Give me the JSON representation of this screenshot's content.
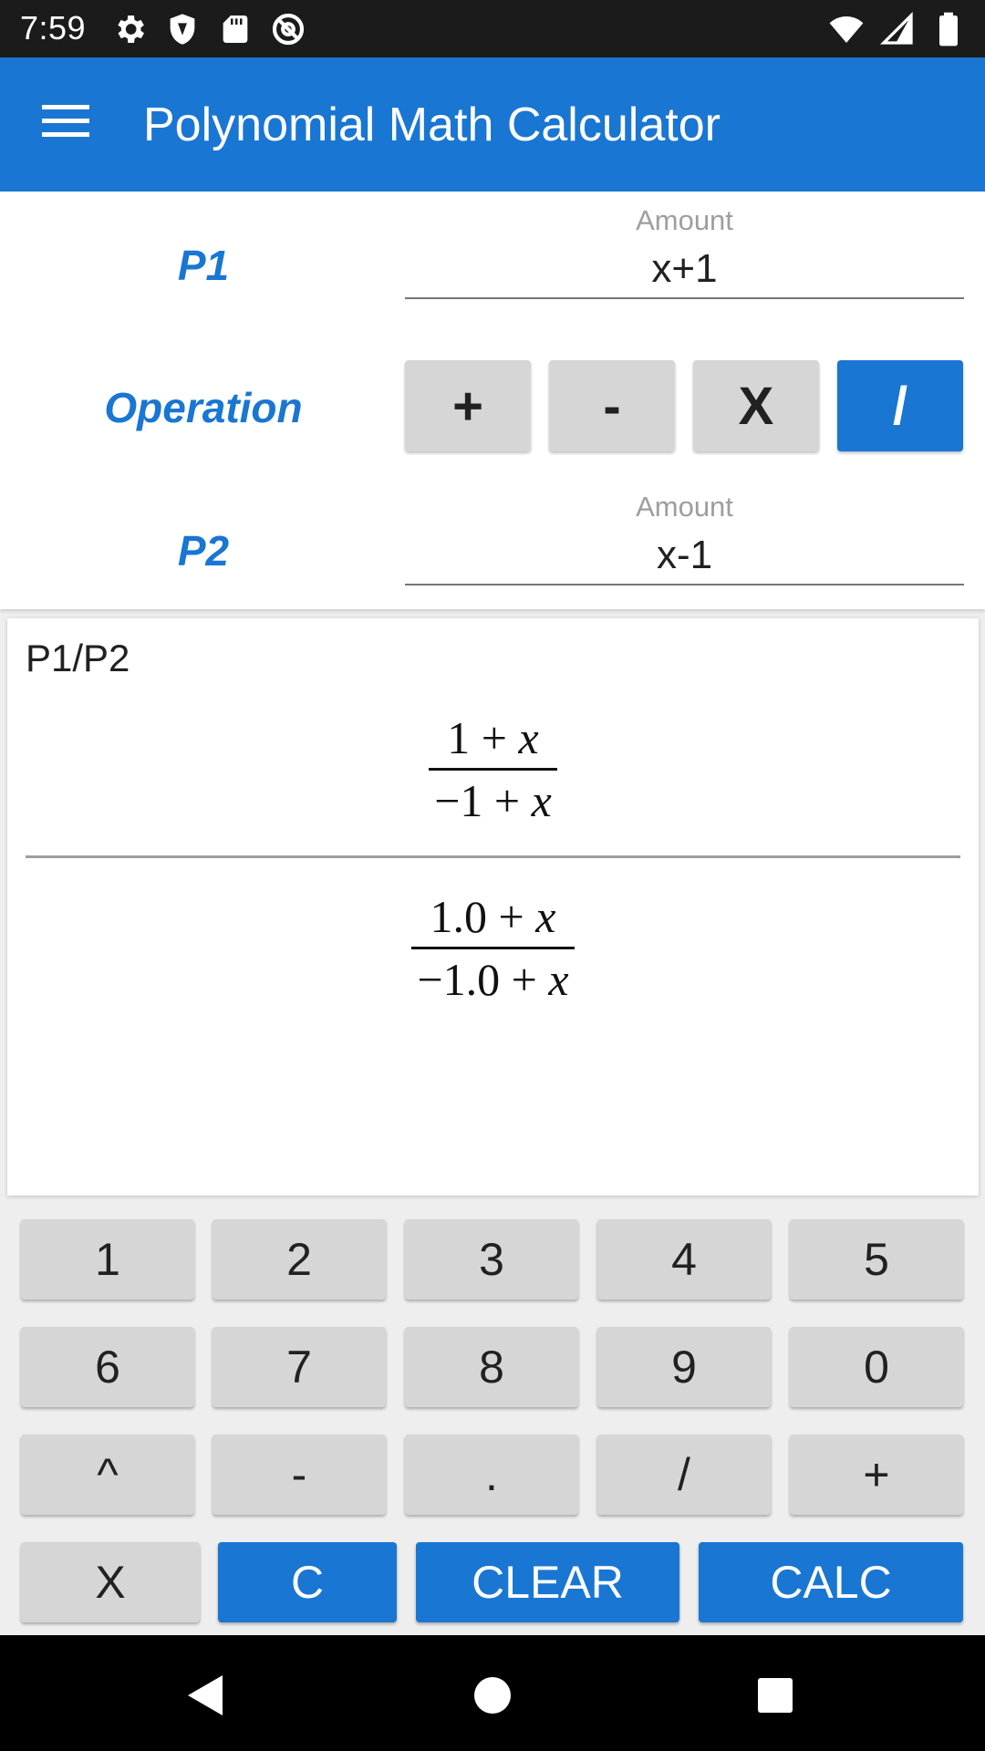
{
  "status_bar": {
    "time": "7:59",
    "left_icons": [
      "gear-icon",
      "shield-icon",
      "sd-card-icon",
      "at-sign-icon"
    ],
    "right_icons": [
      "wifi-icon",
      "signal-icon",
      "battery-icon"
    ]
  },
  "app_bar": {
    "title": "Polynomial Math Calculator",
    "menu_icon": "menu-icon",
    "color": "#1976d2"
  },
  "inputs": {
    "p1": {
      "label": "P1",
      "hint": "Amount",
      "value": "x+1"
    },
    "operation": {
      "label": "Operation",
      "options": [
        "+",
        "-",
        "X",
        "/"
      ],
      "selected": "/"
    },
    "p2": {
      "label": "P2",
      "hint": "Amount",
      "value": "x-1"
    }
  },
  "result": {
    "label": "P1/P2",
    "exact": {
      "numerator_const": "1",
      "numerator_op": " + ",
      "numerator_var": "x",
      "denominator_const": "−1",
      "denominator_op": " + ",
      "denominator_var": "x"
    },
    "decimal": {
      "numerator_const": "1.0",
      "numerator_op": " + ",
      "numerator_var": "x",
      "denominator_const": "−1.0",
      "denominator_op": " + ",
      "denominator_var": "x"
    }
  },
  "keypad": {
    "row1": [
      "1",
      "2",
      "3",
      "4",
      "5"
    ],
    "row2": [
      "6",
      "7",
      "8",
      "9",
      "0"
    ],
    "row3": [
      "^",
      "-",
      ".",
      "/",
      "+"
    ],
    "row4": [
      "X",
      "C",
      "CLEAR",
      "CALC"
    ]
  },
  "nav_bar": {
    "icons": [
      "back-icon",
      "home-icon",
      "recents-icon"
    ]
  },
  "colors": {
    "accent": "#1976d2",
    "key_gray": "#d6d6d6"
  }
}
